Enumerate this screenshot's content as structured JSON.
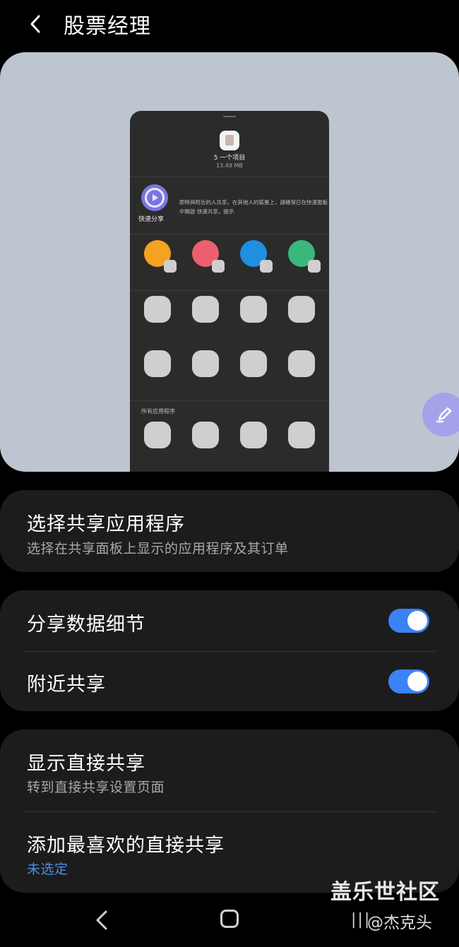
{
  "header": {
    "title": "股票经理"
  },
  "preview": {
    "items_count": "5 一个项目",
    "items_size": "13.49 MB",
    "quick_share_label": "快速分享",
    "quick_share_desc": "即時與附近的人共享。在其他人的裝置上，請確保已在快速面板中開啟 快速共享。提示",
    "all_apps_label": "所有应用程序",
    "contact_colors": [
      "#f6a221",
      "#ec5f6e",
      "#1f8fe0",
      "#3bb77e"
    ]
  },
  "cards": {
    "choose_apps": {
      "title": "选择共享应用程序",
      "subtitle": "选择在共享面板上显示的应用程序及其订单"
    },
    "share_data_details": {
      "title": "分享数据细节",
      "enabled": true
    },
    "nearby_share": {
      "title": "附近共享",
      "enabled": true
    },
    "show_direct_share": {
      "title": "显示直接共享",
      "subtitle": "转到直接共享设置页面"
    },
    "add_favorite_direct_share": {
      "title": "添加最喜欢的直接共享",
      "subtitle": "未选定"
    }
  },
  "nav": {
    "recents_glyph": "|||"
  },
  "watermark": {
    "line1": "盖乐世社区",
    "line2": "@杰克头"
  },
  "colors": {
    "accent": "#3b82f6",
    "card_bg": "#1c1c1c",
    "preview_bg": "#bdc5d0",
    "fab": "#a6a2e9"
  }
}
